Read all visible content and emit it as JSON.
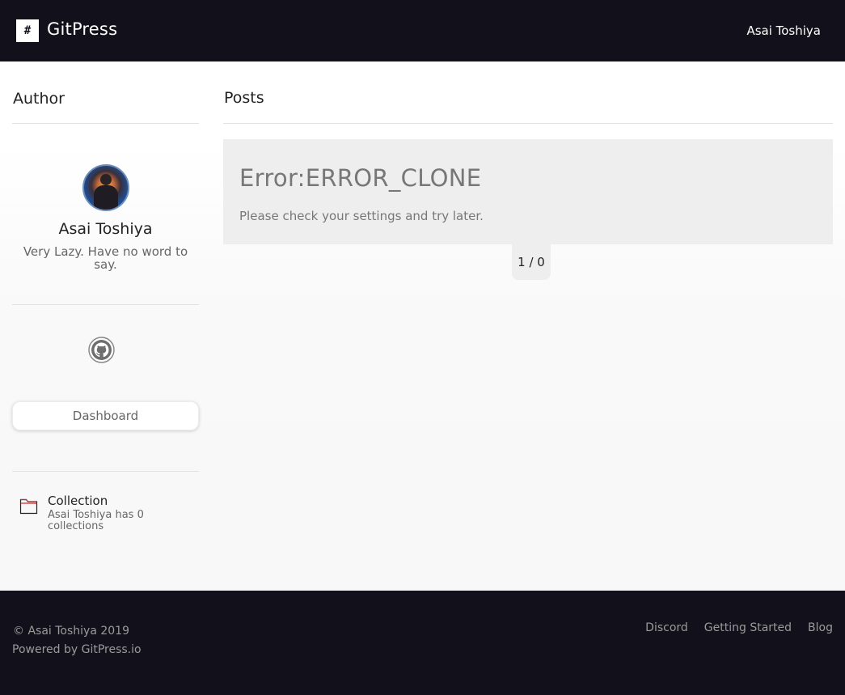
{
  "header": {
    "logo_glyph": "#",
    "brand": "GitPress",
    "user": "Asai Toshiya"
  },
  "sidebar": {
    "title": "Author",
    "author_name": "Asai Toshiya",
    "author_bio": "Very Lazy. Have no word to say.",
    "social_icon": "github-icon",
    "dashboard_label": "Dashboard",
    "collection": {
      "icon": "folder-icon",
      "title": "Collection",
      "description": "Asai Toshiya has 0 collections"
    }
  },
  "main": {
    "title": "Posts",
    "error": {
      "title": "Error:ERROR_CLONE",
      "message": "Please check your settings and try later."
    },
    "pager": "1 / 0"
  },
  "footer": {
    "copyright": "© Asai Toshiya 2019",
    "powered": "Powered by GitPress.io",
    "links": [
      "Discord",
      "Getting Started",
      "Blog"
    ]
  },
  "colors": {
    "header_bg": "#12111b",
    "error_bg": "#eeeeee",
    "muted_text": "#777777"
  }
}
